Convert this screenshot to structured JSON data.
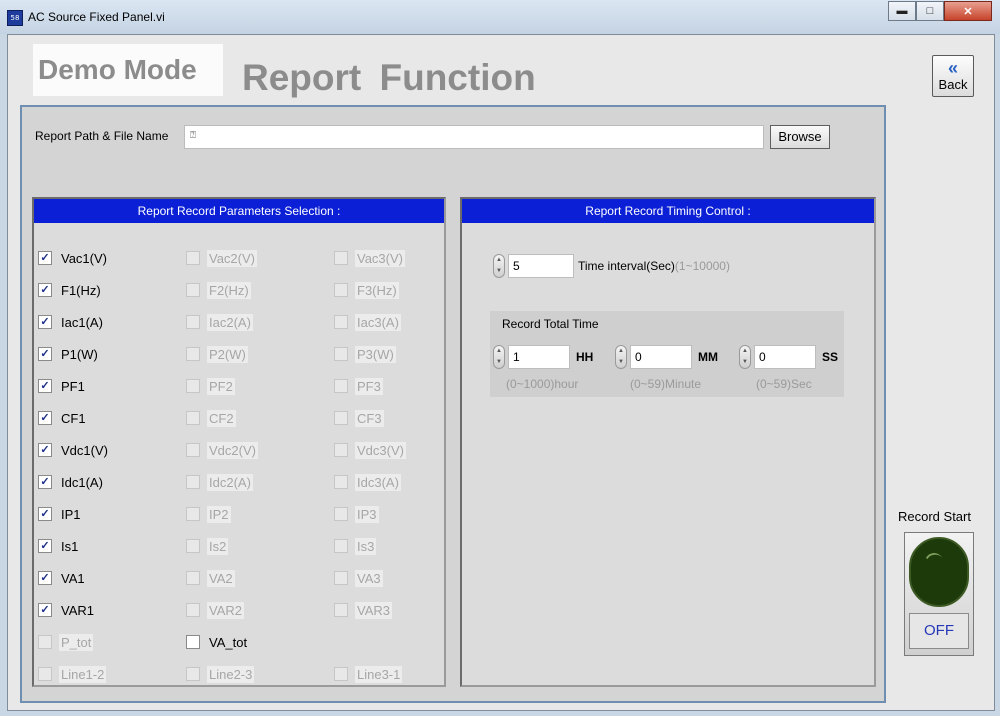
{
  "window": {
    "title": "AC Source Fixed Panel.vi",
    "app_icon_text": "58",
    "controls": {
      "minimize": "▬",
      "maximize": "□",
      "close": "✕"
    }
  },
  "header": {
    "mode_label": "Demo Mode",
    "title": "Report Function",
    "back_arrow": "«",
    "back_label": "Back"
  },
  "report_path": {
    "label": "Report Path & File Name",
    "value": "",
    "icon": "file-path-icon",
    "browse_label": "Browse"
  },
  "params": {
    "header": "Report Record Parameters Selection :",
    "rows": [
      [
        {
          "label": "Vac1(V)",
          "checked": true,
          "enabled": true
        },
        {
          "label": "Vac2(V)",
          "checked": false,
          "enabled": false
        },
        {
          "label": "Vac3(V)",
          "checked": false,
          "enabled": false
        }
      ],
      [
        {
          "label": "F1(Hz)",
          "checked": true,
          "enabled": true
        },
        {
          "label": "F2(Hz)",
          "checked": false,
          "enabled": false
        },
        {
          "label": "F3(Hz)",
          "checked": false,
          "enabled": false
        }
      ],
      [
        {
          "label": "Iac1(A)",
          "checked": true,
          "enabled": true
        },
        {
          "label": "Iac2(A)",
          "checked": false,
          "enabled": false
        },
        {
          "label": "Iac3(A)",
          "checked": false,
          "enabled": false
        }
      ],
      [
        {
          "label": "P1(W)",
          "checked": true,
          "enabled": true
        },
        {
          "label": "P2(W)",
          "checked": false,
          "enabled": false
        },
        {
          "label": "P3(W)",
          "checked": false,
          "enabled": false
        }
      ],
      [
        {
          "label": "PF1",
          "checked": true,
          "enabled": true
        },
        {
          "label": "PF2",
          "checked": false,
          "enabled": false
        },
        {
          "label": "PF3",
          "checked": false,
          "enabled": false
        }
      ],
      [
        {
          "label": "CF1",
          "checked": true,
          "enabled": true
        },
        {
          "label": "CF2",
          "checked": false,
          "enabled": false
        },
        {
          "label": "CF3",
          "checked": false,
          "enabled": false
        }
      ],
      [
        {
          "label": "Vdc1(V)",
          "checked": true,
          "enabled": true
        },
        {
          "label": "Vdc2(V)",
          "checked": false,
          "enabled": false
        },
        {
          "label": "Vdc3(V)",
          "checked": false,
          "enabled": false
        }
      ],
      [
        {
          "label": "Idc1(A)",
          "checked": true,
          "enabled": true
        },
        {
          "label": "Idc2(A)",
          "checked": false,
          "enabled": false
        },
        {
          "label": "Idc3(A)",
          "checked": false,
          "enabled": false
        }
      ],
      [
        {
          "label": "IP1",
          "checked": true,
          "enabled": true
        },
        {
          "label": "IP2",
          "checked": false,
          "enabled": false
        },
        {
          "label": "IP3",
          "checked": false,
          "enabled": false
        }
      ],
      [
        {
          "label": "Is1",
          "checked": true,
          "enabled": true
        },
        {
          "label": "Is2",
          "checked": false,
          "enabled": false
        },
        {
          "label": "Is3",
          "checked": false,
          "enabled": false
        }
      ],
      [
        {
          "label": "VA1",
          "checked": true,
          "enabled": true
        },
        {
          "label": "VA2",
          "checked": false,
          "enabled": false
        },
        {
          "label": "VA3",
          "checked": false,
          "enabled": false
        }
      ],
      [
        {
          "label": "VAR1",
          "checked": true,
          "enabled": true
        },
        {
          "label": "VAR2",
          "checked": false,
          "enabled": false
        },
        {
          "label": "VAR3",
          "checked": false,
          "enabled": false
        }
      ],
      [
        {
          "label": "P_tot",
          "checked": false,
          "enabled": false
        },
        {
          "label": "VA_tot",
          "checked": false,
          "enabled": true
        }
      ],
      [
        {
          "label": "Line1-2",
          "checked": false,
          "enabled": false
        },
        {
          "label": "Line2-3",
          "checked": false,
          "enabled": false
        },
        {
          "label": "Line3-1",
          "checked": false,
          "enabled": false
        }
      ]
    ]
  },
  "timing": {
    "header": "Report Record Timing Control :",
    "interval": {
      "value": "5",
      "label": "Time interval(Sec)",
      "range": "(1~10000)"
    },
    "total_title": "Record Total Time",
    "hh": {
      "value": "1",
      "unit": "HH",
      "range": "(0~1000)hour"
    },
    "mm": {
      "value": "0",
      "unit": "MM",
      "range": "(0~59)Minute"
    },
    "ss": {
      "value": "0",
      "unit": "SS",
      "range": "(0~59)Sec"
    }
  },
  "record": {
    "label": "Record Start",
    "state": "OFF",
    "led_color": "#1c3a0a"
  },
  "colors": {
    "panel_header": "#0a1fd6",
    "check_mark": "#1c2f8f",
    "off_text": "#2438b8"
  }
}
